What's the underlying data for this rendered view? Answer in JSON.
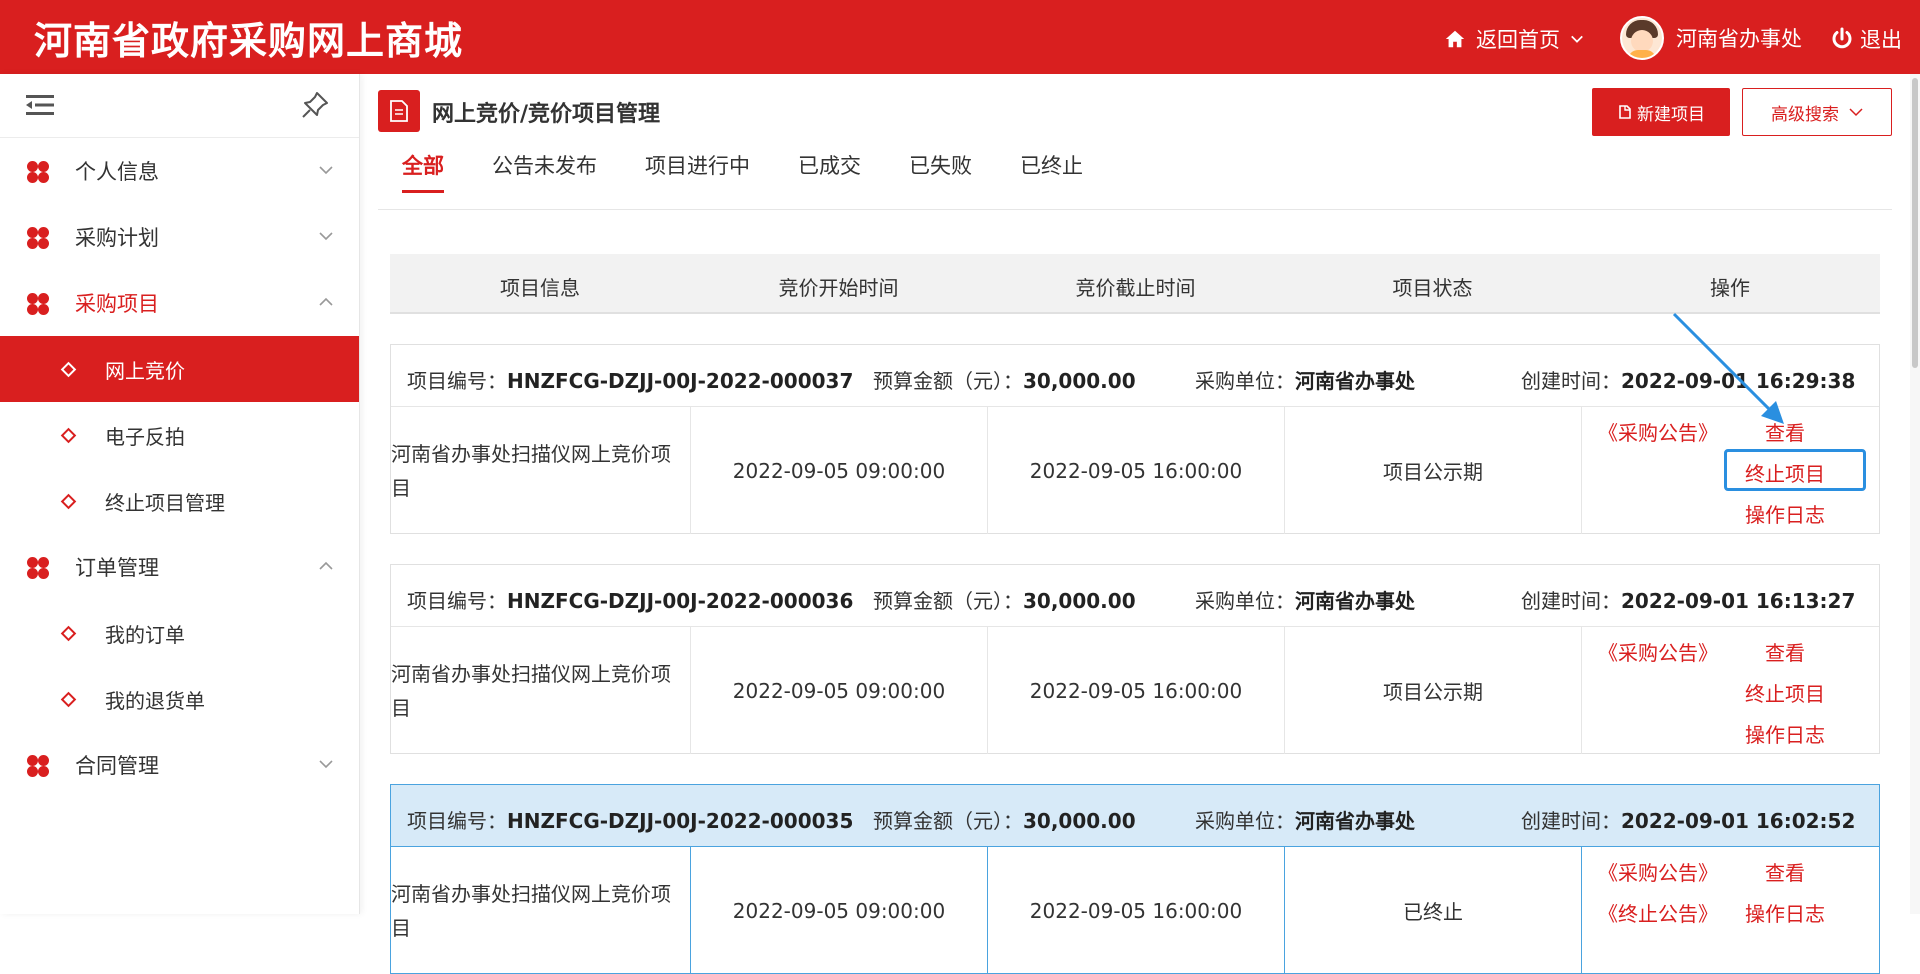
{
  "header": {
    "brand": "河南省政府采购网上商城",
    "home_label": "返回首页",
    "user_name": "河南省办事处",
    "logout_label": "退出"
  },
  "sidebar": {
    "items": [
      {
        "label": "个人信息"
      },
      {
        "label": "采购计划"
      },
      {
        "label": "采购项目"
      },
      {
        "label": "网上竞价"
      },
      {
        "label": "电子反拍"
      },
      {
        "label": "终止项目管理"
      },
      {
        "label": "订单管理"
      },
      {
        "label": "我的订单"
      },
      {
        "label": "我的退货单"
      },
      {
        "label": "合同管理"
      }
    ]
  },
  "main": {
    "page_title": "网上竞价/竞价项目管理",
    "new_button": "新建项目",
    "advanced_search": "高级搜索",
    "tabs": [
      "全部",
      "公告未发布",
      "项目进行中",
      "已成交",
      "已失败",
      "已终止"
    ],
    "active_tab": "全部",
    "columns": [
      "项目信息",
      "竞价开始时间",
      "竞价截止时间",
      "项目状态",
      "操作"
    ],
    "labels": {
      "code": "项目编号：",
      "budget": "预算金额（元）：",
      "unit": "采购单位：",
      "created": "创建时间："
    },
    "projects": [
      {
        "code": "HNZFCG-DZJJ-00J-2022-000037",
        "budget": "30,000.00",
        "unit": "河南省办事处",
        "created": "2022-09-01 16:29:38",
        "name": "河南省办事处扫描仪网上竞价项目",
        "start": "2022-09-05 09:00:00",
        "end": "2022-09-05 16:00:00",
        "status": "项目公示期",
        "ops": [
          "《采购公告》",
          "查看",
          "终止项目",
          "操作日志"
        ]
      },
      {
        "code": "HNZFCG-DZJJ-00J-2022-000036",
        "budget": "30,000.00",
        "unit": "河南省办事处",
        "created": "2022-09-01 16:13:27",
        "name": "河南省办事处扫描仪网上竞价项目",
        "start": "2022-09-05 09:00:00",
        "end": "2022-09-05 16:00:00",
        "status": "项目公示期",
        "ops": [
          "《采购公告》",
          "查看",
          "终止项目",
          "操作日志"
        ]
      },
      {
        "code": "HNZFCG-DZJJ-00J-2022-000035",
        "budget": "30,000.00",
        "unit": "河南省办事处",
        "created": "2022-09-01 16:02:52",
        "name": "河南省办事处扫描仪网上竞价项目",
        "start": "2022-09-05 09:00:00",
        "end": "2022-09-05 16:00:00",
        "status": "已终止",
        "ops": [
          "《采购公告》",
          "查看",
          "《终止公告》",
          "操作日志"
        ]
      }
    ]
  },
  "colors": {
    "brand_red": "#d91f1f",
    "highlight_blue": "#2a8fe0",
    "hover_row_bg": "#d7eaf8"
  }
}
